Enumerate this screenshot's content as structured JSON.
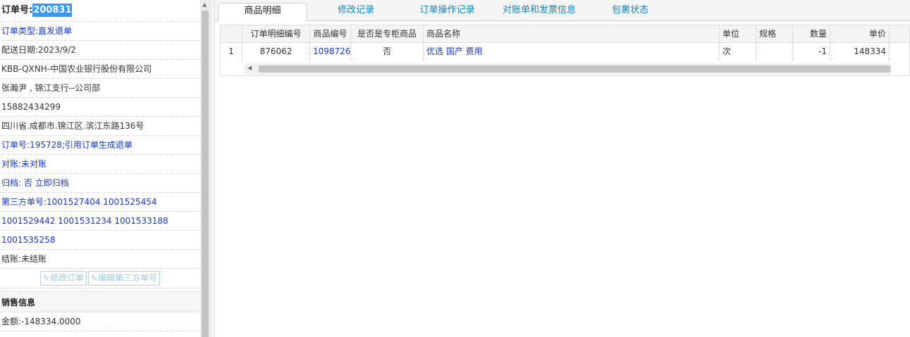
{
  "order": {
    "id_label": "订单号:",
    "id_value": "200831",
    "type": "订单类型:直发退单",
    "delivery_date": "配送日期:2023/9/2",
    "company": "KBB-QXNH-中国农业银行股份有限公司",
    "contact": "张瀚尹 , 锦江支行--公司部",
    "phone": "15882434299",
    "address": "四川省.成都市.锦江区.滨江东路136号",
    "ref": "订单号:195728;引用订单生成退单",
    "reconcile": "对账:未对账",
    "archive": "归档: 否 立即归档",
    "third_party_1": "第三方单号:1001527404 1001525454",
    "third_party_2": "1001529442 1001531234 1001533188",
    "third_party_3": "1001535258",
    "settlement": "结账:未结账",
    "btn_edit_order": "修改订单",
    "btn_edit_third": "编辑第三方单号"
  },
  "sales": {
    "section_title": "销售信息",
    "amount": "金额:-148334.0000"
  },
  "tabs": [
    {
      "label": "商品明细",
      "active": true
    },
    {
      "label": "修改记录",
      "active": false
    },
    {
      "label": "订单操作记录",
      "active": false
    },
    {
      "label": "对账单和发票信息",
      "active": false
    },
    {
      "label": "包裹状态",
      "active": false
    }
  ],
  "grid": {
    "columns": [
      "",
      "订单明细编号",
      "商品编号",
      "是否是专柜商品",
      "商品名称",
      "单位",
      "规格",
      "数量",
      "单价"
    ],
    "rows": [
      [
        "1",
        "876062",
        "1098726",
        "否",
        "优选 国产 费用",
        "次",
        "",
        "-1",
        "148334"
      ]
    ]
  },
  "colors": {
    "link_blue": "#1a37c9",
    "tab_blue": "#0e87c4",
    "highlight": "#3399ff"
  }
}
